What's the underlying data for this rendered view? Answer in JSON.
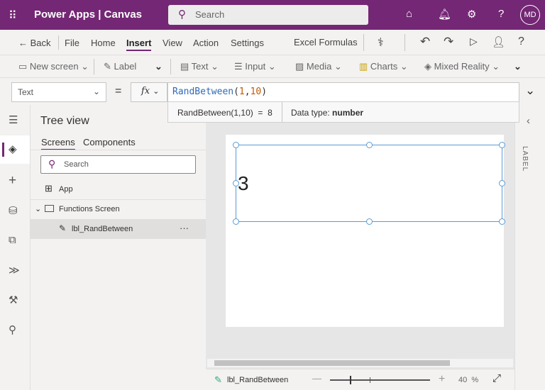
{
  "header": {
    "app_title": "Power Apps | Canvas",
    "search_placeholder": "Search",
    "avatar": "MD"
  },
  "menu": {
    "back": "Back",
    "items": [
      "File",
      "Home",
      "Insert",
      "View",
      "Action",
      "Settings"
    ],
    "active": "Insert",
    "excel": "Excel Formulas"
  },
  "toolbar": {
    "new_screen": "New screen",
    "label": "Label",
    "text": "Text",
    "input": "Input",
    "media": "Media",
    "charts": "Charts",
    "mixed_reality": "Mixed Reality"
  },
  "formula_bar": {
    "property": "Text",
    "equals": "=",
    "fx": "fx",
    "func": "RandBetween",
    "open": "(",
    "arg1": "1",
    "comma": ",",
    "arg2": "10",
    "close": ")",
    "result_expr": "RandBetween(1,10)",
    "result_eq": "=",
    "result_value": "8",
    "data_type_label": "Data type:",
    "data_type": "number"
  },
  "tree": {
    "title": "Tree view",
    "tabs": [
      "Screens",
      "Components"
    ],
    "search_placeholder": "Search",
    "app": "App",
    "screen": "Functions Screen",
    "control": "lbl_RandBetween",
    "more": "···"
  },
  "canvas": {
    "label_value": "3"
  },
  "right_panel": {
    "label": "LABEL"
  },
  "status": {
    "selected": "lbl_RandBetween",
    "zoom": "40",
    "zoom_unit": "%",
    "zoom_fraction": 0.2
  }
}
